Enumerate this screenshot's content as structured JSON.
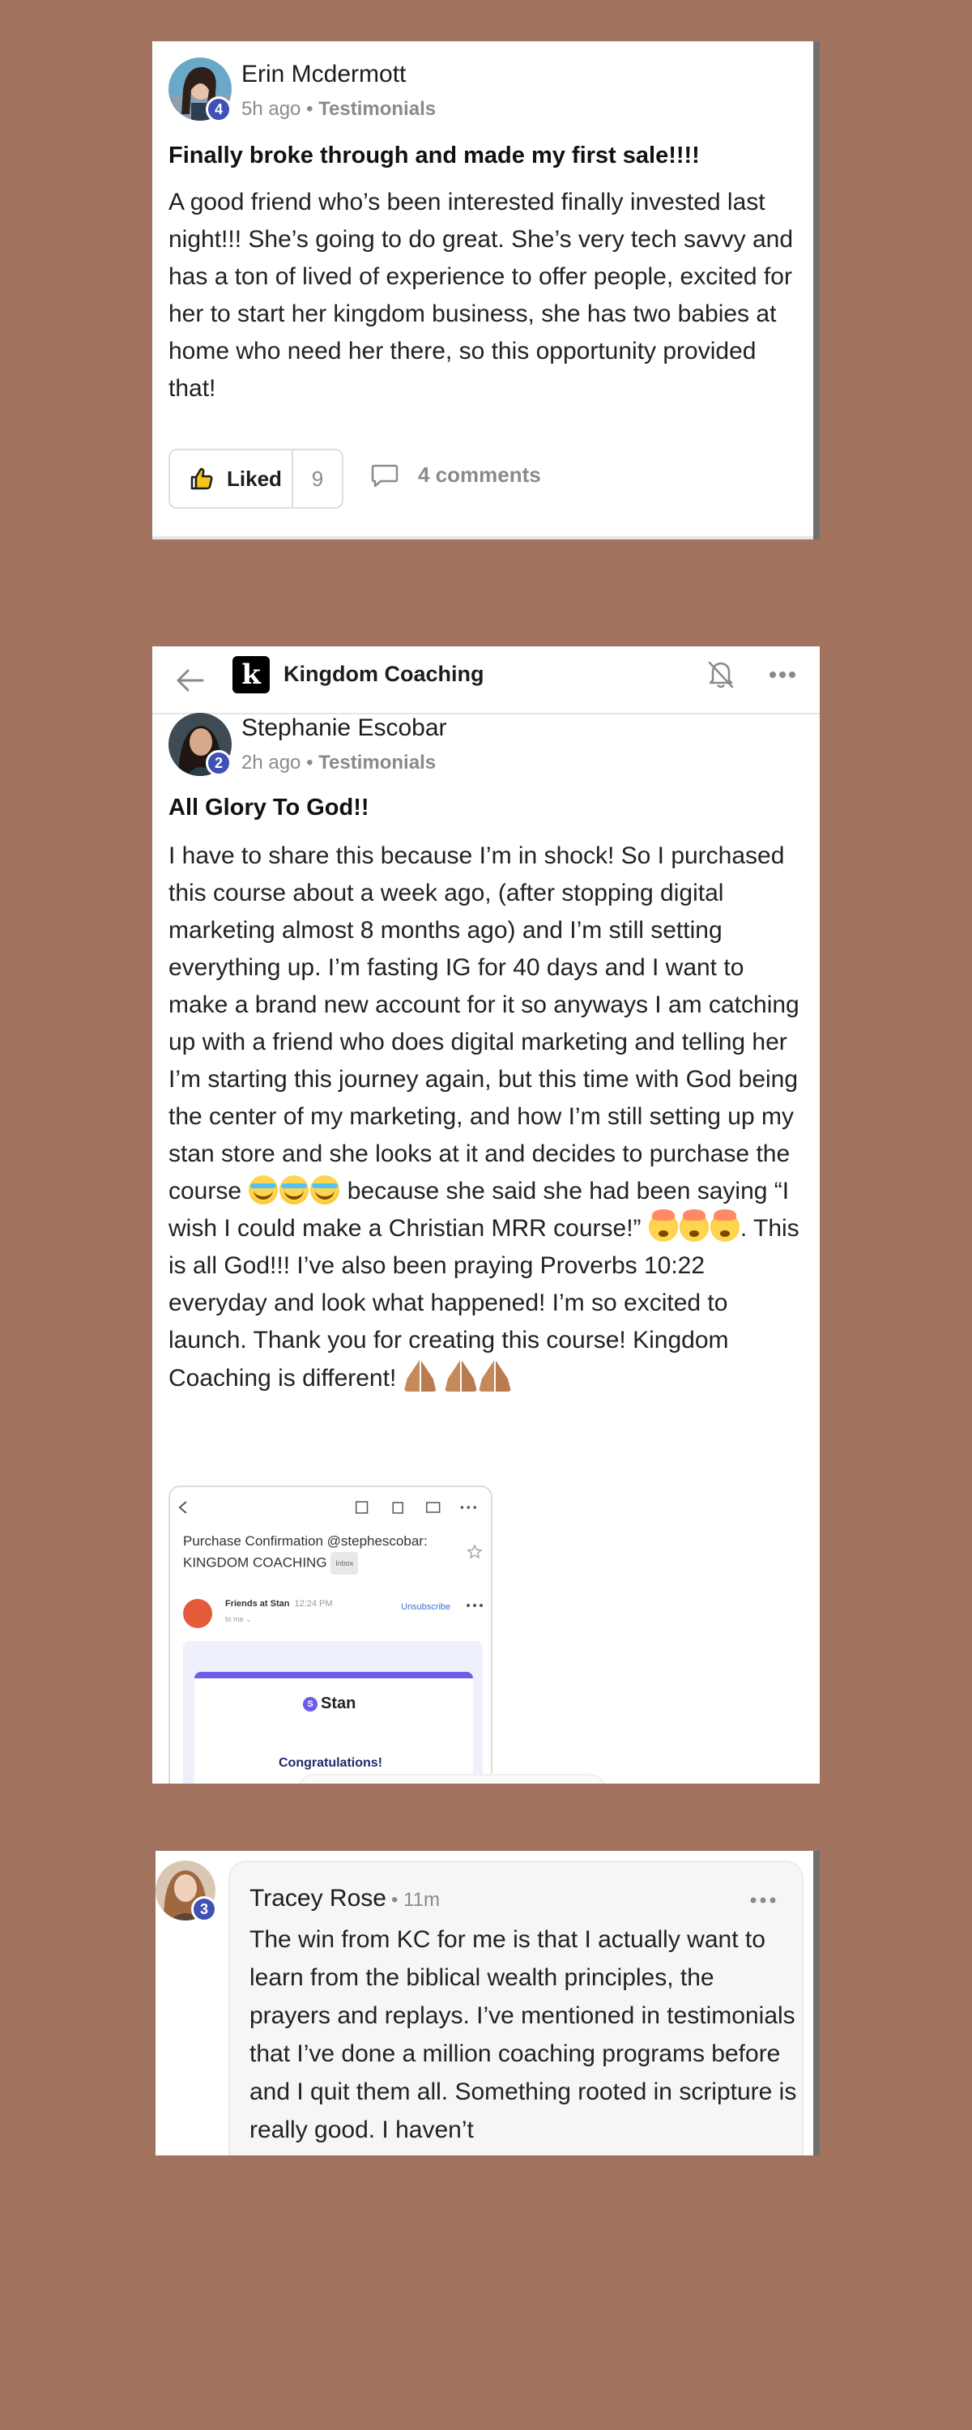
{
  "posts": [
    {
      "author": "Erin Mcdermott",
      "level": "4",
      "time": "5h ago",
      "separator": "•",
      "category": "Testimonials",
      "title": "Finally broke through and made my first sale!!!!",
      "body": "A good friend who’s been interested finally invested last night!!! She’s going to do great. She’s very tech savvy and has a ton of lived of experience to offer people, excited for her to start her kingdom business, she has two babies at home who need her there, so this opportunity provided that!",
      "like_label": "Liked",
      "like_count": "9",
      "comments_label": "4 comments"
    },
    {
      "author": "Stephanie Escobar",
      "level": "2",
      "time": "2h ago",
      "separator": "•",
      "category": "Testimonials",
      "title": "All Glory To God!!",
      "body_parts": [
        "I have to share this because I’m in shock! So I purchased this course about a week ago, (after stopping digital marketing almost 8 months ago) and I’m still setting everything up. I’m fasting IG for 40 days and I want to make a brand new account for it so anyways I am catching up with a friend who does digital marketing and telling her I’m starting this journey again, but this time with God being the center of my marketing, and how I’m still setting up my stan store and she looks at it and decides to purchase the course ",
        " because she said she had been saying “I wish I could make a Christian MRR course!” ",
        ". This is all God!!! I’ve also been praying Proverbs 10:22 everyday and look what happened! I’m so excited to launch. Thank you for creating this course! Kingdom Coaching is different! "
      ],
      "attachment": {
        "subject": "Purchase Confirmation @stephescobar: KINGDOM COACHING",
        "inbox_chip": "Inbox",
        "sender": "Friends at Stan",
        "sender_time": "12:24 PM",
        "to": "to me ⌄",
        "unsubscribe": "Unsubscribe",
        "brand": "Stan",
        "brand_mark": "S",
        "congrats": "Congratulations!"
      }
    }
  ],
  "group_header": {
    "logo_letter": "k",
    "group_name": "Kingdom Coaching"
  },
  "comment": {
    "author": "Tracey Rose",
    "level": "3",
    "time": "• 11m",
    "body": "The win from KC for me is that I actually want to learn from the biblical wealth principles, the prayers and replays. I’ve mentioned in testimonials that I’ve done a million coaching programs before and I quit them all. Something rooted in scripture is really good. I haven’t"
  },
  "colors": {
    "background": "#a1735e",
    "badge": "#3f51b5",
    "muted_text": "#8a8a8a",
    "stan_purple": "#6c5ce7"
  }
}
